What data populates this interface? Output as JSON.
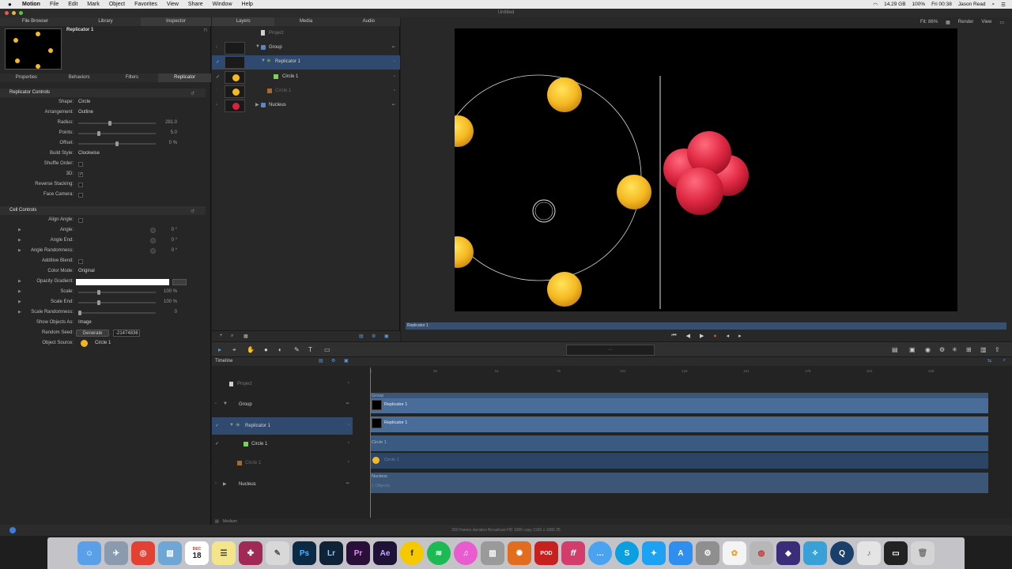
{
  "menubar": {
    "app": "Motion",
    "items": [
      "File",
      "Edit",
      "Mark",
      "Object",
      "Favorites",
      "View",
      "Share",
      "Window",
      "Help"
    ],
    "disk": "14.29 GB",
    "battery": "100%",
    "clock": "Fri 00:38",
    "user": "Jason Read"
  },
  "window": {
    "title": "Untitled"
  },
  "left_tabs": [
    "File Browser",
    "Library",
    "Inspector"
  ],
  "inspector": {
    "title": "Replicator 1",
    "tabs": [
      "Properties",
      "Behaviors",
      "Filters",
      "Replicator"
    ],
    "replicator_controls": {
      "header": "Replicator Controls",
      "shape_label": "Shape:",
      "shape": "Circle",
      "arrangement_label": "Arrangement:",
      "arrangement": "Outline",
      "radius_label": "Radius:",
      "radius": "281.0",
      "radius_fill": 0.4,
      "points_label": "Points:",
      "points": "5.0",
      "points_fill": 0.26,
      "offset_label": "Offset:",
      "offset": "0 %",
      "offset_fill": 0.5,
      "build_style_label": "Build Style:",
      "build_style": "Clockwise",
      "shuffle_order_label": "Shuffle Order:",
      "three_d_label": "3D:",
      "reverse_stacking_label": "Reverse Stacking:",
      "face_camera_label": "Face Camera:"
    },
    "cell_controls": {
      "header": "Cell Controls",
      "align_angle_label": "Align Angle:",
      "angle_label": "Angle:",
      "angle": "0 °",
      "angle_end_label": "Angle End:",
      "angle_end": "0 °",
      "angle_rand_label": "Angle Randomness:",
      "angle_rand": "0 °",
      "additive_blend_label": "Additive Blend:",
      "color_mode_label": "Color Mode:",
      "color_mode": "Original",
      "opacity_gradient_label": "Opacity Gradient:",
      "scale_label": "Scale:",
      "scale": "100 %",
      "scale_fill": 0.26,
      "scale_end_label": "Scale End:",
      "scale_end": "100 %",
      "scale_end_fill": 0.26,
      "scale_rand_label": "Scale Randomness:",
      "scale_rand": "0",
      "scale_rand_fill": 0.0,
      "show_objects_label": "Show Objects As:",
      "show_objects": "Image",
      "random_seed_label": "Random Seed:",
      "generate_label": "Generate",
      "random_seed": "-21474836",
      "object_source_label": "Object Source:",
      "object_source": "Circle 1"
    }
  },
  "layers": {
    "tabs": [
      "Layers",
      "Media",
      "Audio"
    ],
    "project": "Project",
    "rows": [
      {
        "name": "Group"
      },
      {
        "name": "Replicator 1"
      },
      {
        "name": "Circle 1"
      },
      {
        "name": "Circle 1"
      },
      {
        "name": "Nucleus"
      }
    ]
  },
  "canvas": {
    "fit_label": "Fit: 86%",
    "render_label": "Render",
    "view_label": "View",
    "mini_timeline_label": "Replicator 1"
  },
  "timeline": {
    "header": "Timeline",
    "project": "Project",
    "rows": [
      "Group",
      "Replicator 1",
      "Circle 1",
      "Circle 1",
      "Nucleus"
    ],
    "ruler": [
      "1",
      "26",
      "51",
      "76",
      "101",
      "126",
      "151",
      "176",
      "201",
      "226"
    ],
    "bars": {
      "group": "Group",
      "rep1": "Replicator 1",
      "rep2": "Replicator 1",
      "circle_a": "Circle 1",
      "circle_b": "Circle 1",
      "nucleus": "Nucleus",
      "nucleus_sub": "1 Objects"
    },
    "footer": "Medium"
  },
  "status": "250 frames duration  Broadcast HD 1080 copy 1920 x 1080 25",
  "colors": {
    "accent": "#2f4a6e",
    "bar": "#4a6c98",
    "yellow": "#f5b922",
    "red": "#d8233c"
  },
  "dock": [
    "Finder",
    "Launchpad",
    "Chrome",
    "Preview",
    "Calendar",
    "Notes",
    "DaVinci",
    "Pencil",
    "Ps",
    "Lr",
    "Pr",
    "Ae",
    "Fontastic",
    "Spotify",
    "iTunes",
    "Compressor",
    "Pixelmator",
    "POD",
    "ff",
    "Messages",
    "Skype",
    "Twitter",
    "App Store",
    "Preferences",
    "Photos",
    "Web",
    "Vectorize",
    "Pixel",
    "QuickTime",
    "Music",
    "Terminal",
    "Trash"
  ],
  "dock_calendar_day": "18",
  "dock_calendar_month": "DEC"
}
